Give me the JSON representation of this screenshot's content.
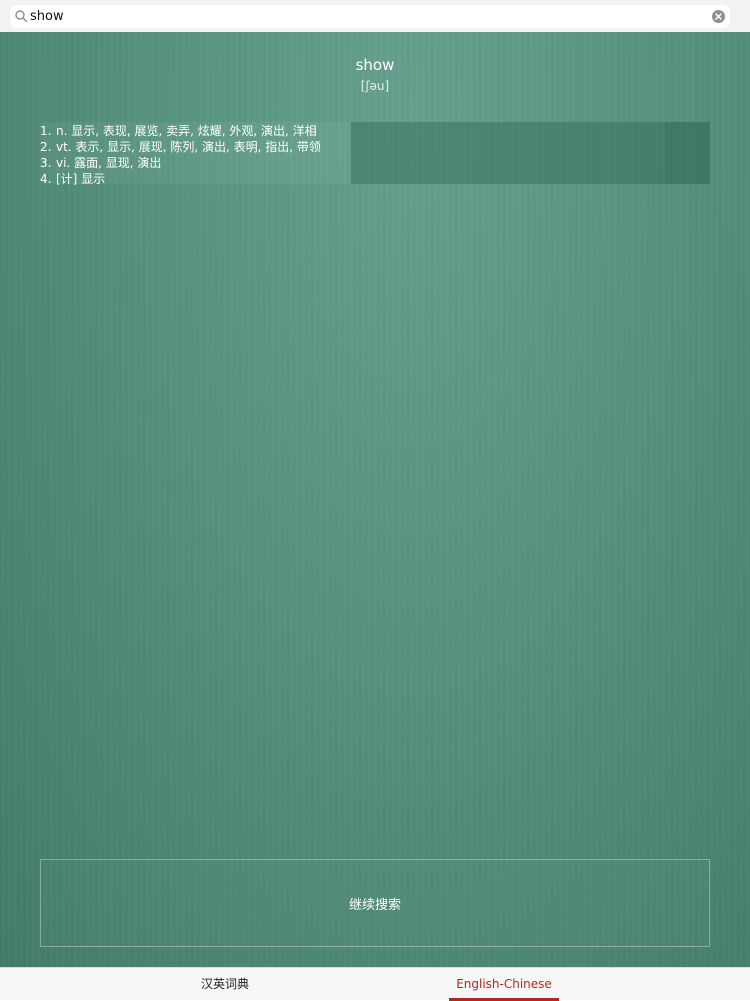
{
  "search": {
    "value": "show",
    "placeholder": ""
  },
  "entry": {
    "word": "show",
    "phonetic": "[ʃəu]",
    "definitions": [
      {
        "num": "1.",
        "text": "n. 显示, 表现, 展览, 卖弄, 炫耀, 外观, 演出, 洋相"
      },
      {
        "num": "2.",
        "text": "vt. 表示, 显示, 展现, 陈列, 演出, 表明, 指出, 带领"
      },
      {
        "num": "3.",
        "text": "vi. 露面, 显现, 演出"
      },
      {
        "num": "4.",
        "text": "[计] 显示"
      }
    ]
  },
  "continue_label": "继续搜索",
  "tabs": [
    {
      "label": "汉英词典",
      "active": false
    },
    {
      "label": "English-Chinese",
      "active": true
    }
  ],
  "colors": {
    "accent": "#b22a1e",
    "background": "#5a9683"
  },
  "icons": {
    "search": "search-icon",
    "clear": "clear-icon"
  }
}
